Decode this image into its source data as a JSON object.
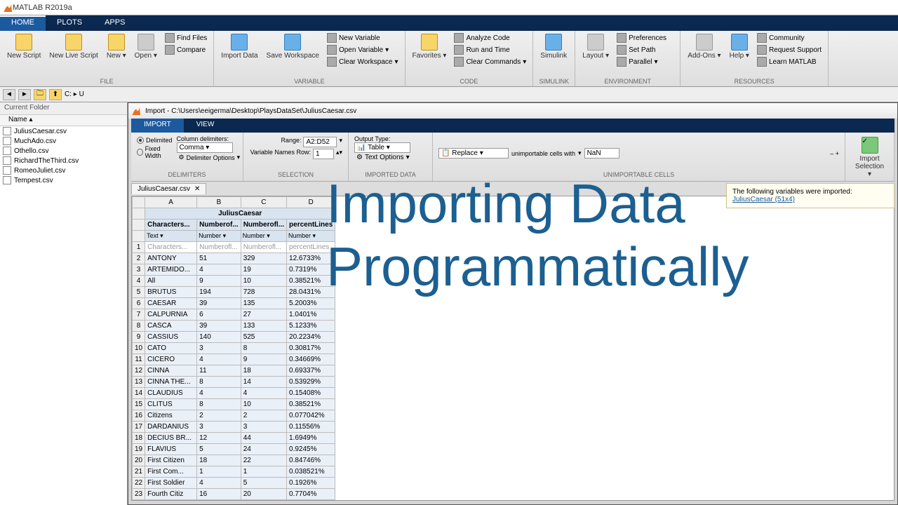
{
  "app_title": "MATLAB R2019a",
  "main_tabs": [
    "HOME",
    "PLOTS",
    "APPS"
  ],
  "toolstrip": {
    "file": {
      "new_script": "New\nScript",
      "new_live": "New\nLive Script",
      "new": "New",
      "open": "Open",
      "find_files": "Find Files",
      "compare": "Compare",
      "label": "FILE"
    },
    "variable": {
      "import": "Import\nData",
      "save_ws": "Save\nWorkspace",
      "new_var": "New Variable",
      "open_var": "Open Variable",
      "clear_ws": "Clear Workspace",
      "label": "VARIABLE"
    },
    "code": {
      "fav": "Favorites",
      "analyze": "Analyze Code",
      "run_time": "Run and Time",
      "clear_cmd": "Clear Commands",
      "label": "CODE"
    },
    "simulink": {
      "btn": "Simulink",
      "label": "SIMULINK"
    },
    "env": {
      "layout": "Layout",
      "prefs": "Preferences",
      "path": "Set Path",
      "parallel": "Parallel",
      "label": "ENVIRONMENT"
    },
    "res": {
      "addons": "Add-Ons",
      "help": "Help",
      "community": "Community",
      "support": "Request Support",
      "learn": "Learn MATLAB",
      "label": "RESOURCES"
    }
  },
  "path": "C: ▸ U",
  "current_folder": {
    "title": "Current Folder",
    "col": "Name",
    "files": [
      "JuliusCaesar.csv",
      "MuchAdo.csv",
      "Othello.csv",
      "RichardTheThird.csv",
      "RomeoJuliet.csv",
      "Tempest.csv"
    ]
  },
  "import": {
    "title": "Import - C:\\Users\\eeigerma\\Desktop\\PlaysDataSet\\JuliusCaesar.csv",
    "tabs": [
      "IMPORT",
      "VIEW"
    ],
    "delimiters": {
      "label": "Column delimiters:",
      "delimited": "Delimited",
      "fixed": "Fixed Width",
      "combo": "Comma",
      "opts": "Delimiter Options",
      "group": "DELIMITERS"
    },
    "selection": {
      "range_l": "Range:",
      "range": "A2:D52",
      "vnr_l": "Variable Names Row:",
      "vnr": "1",
      "group": "SELECTION"
    },
    "impdata": {
      "out_l": "Output Type:",
      "out": "Table",
      "txt": "Text Options",
      "group": "IMPORTED DATA"
    },
    "unimp": {
      "replace": "Replace",
      "cells": "unimportable cells with",
      "nan": "NaN",
      "group": "UNIMPORTABLE CELLS"
    },
    "impbtn": "Import\nSelection",
    "notif_text": "The following variables were imported:",
    "notif_link": "JuliusCaesar (51x4)",
    "file_tab": "JuliusCaesar.csv"
  },
  "sheet": {
    "cols": [
      "A",
      "B",
      "C",
      "D"
    ],
    "title": "JuliusCaesar",
    "names": [
      "Characters...",
      "Numberof...",
      "Numberofl...",
      "percentLines"
    ],
    "types": [
      "Text",
      "Number",
      "Number",
      "Number"
    ],
    "row1": [
      "Characters...",
      "Numberofl...",
      "Numberofl...",
      "percentLines"
    ],
    "data": [
      [
        "ANTONY",
        "51",
        "329",
        "12.6733%"
      ],
      [
        "ARTEMIDO...",
        "4",
        "19",
        "0.7319%"
      ],
      [
        "All",
        "9",
        "10",
        "0.38521%"
      ],
      [
        "BRUTUS",
        "194",
        "728",
        "28.0431%"
      ],
      [
        "CAESAR",
        "39",
        "135",
        "5.2003%"
      ],
      [
        "CALPURNIA",
        "6",
        "27",
        "1.0401%"
      ],
      [
        "CASCA",
        "39",
        "133",
        "5.1233%"
      ],
      [
        "CASSIUS",
        "140",
        "525",
        "20.2234%"
      ],
      [
        "CATO",
        "3",
        "8",
        "0.30817%"
      ],
      [
        "CICERO",
        "4",
        "9",
        "0.34669%"
      ],
      [
        "CINNA",
        "11",
        "18",
        "0.69337%"
      ],
      [
        "CINNA THE...",
        "8",
        "14",
        "0.53929%"
      ],
      [
        "CLAUDIUS",
        "4",
        "4",
        "0.15408%"
      ],
      [
        "CLITUS",
        "8",
        "10",
        "0.38521%"
      ],
      [
        "Citizens",
        "2",
        "2",
        "0.077042%"
      ],
      [
        "DARDANIUS",
        "3",
        "3",
        "0.11556%"
      ],
      [
        "DECIUS BR...",
        "12",
        "44",
        "1.6949%"
      ],
      [
        "FLAVIUS",
        "5",
        "24",
        "0.9245%"
      ],
      [
        "First Citizen",
        "18",
        "22",
        "0.84746%"
      ],
      [
        "First Com...",
        "1",
        "1",
        "0.038521%"
      ],
      [
        "First Soldier",
        "4",
        "5",
        "0.1926%"
      ],
      [
        "Fourth Citiz",
        "16",
        "20",
        "0.7704%"
      ]
    ]
  },
  "overlay": {
    "l1": "Importing Data",
    "l2": "Programmatically"
  }
}
